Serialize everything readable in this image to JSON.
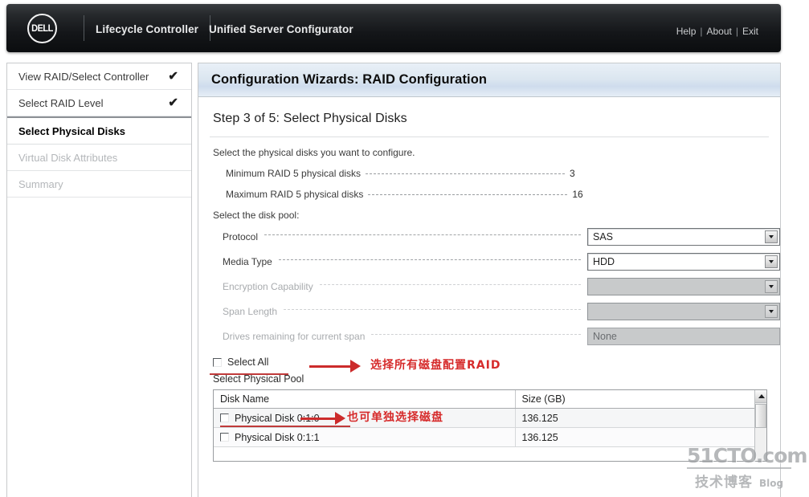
{
  "header": {
    "logo_text": "DELL",
    "brand_primary": "Lifecycle Controller",
    "brand_secondary": "Unified Server Configurator",
    "links": {
      "help": "Help",
      "about": "About",
      "exit": "Exit",
      "separator": "|"
    }
  },
  "sidebar": {
    "items": [
      {
        "label": "View RAID/Select Controller",
        "state": "done",
        "check": "✔"
      },
      {
        "label": "Select RAID Level",
        "state": "done",
        "check": "✔"
      },
      {
        "label": "Select Physical Disks",
        "state": "current",
        "check": ""
      },
      {
        "label": "Virtual Disk Attributes",
        "state": "disabled",
        "check": ""
      },
      {
        "label": "Summary",
        "state": "disabled",
        "check": ""
      }
    ]
  },
  "main": {
    "panel_title": "Configuration Wizards: RAID Configuration",
    "step_title": "Step 3 of 5: Select Physical Disks",
    "instruction": "Select the physical disks you want to configure.",
    "info_rows": [
      {
        "label": "Minimum RAID 5 physical disks",
        "value": "3"
      },
      {
        "label": "Maximum RAID 5 physical disks",
        "value": "16"
      }
    ],
    "disk_pool_heading": "Select the disk pool:",
    "fields": [
      {
        "label": "Protocol",
        "value": "SAS",
        "control": "dropdown",
        "disabled": false
      },
      {
        "label": "Media Type",
        "value": "HDD",
        "control": "dropdown",
        "disabled": false
      },
      {
        "label": "Encryption Capability",
        "value": "",
        "control": "dropdown",
        "disabled": true
      },
      {
        "label": "Span Length",
        "value": "",
        "control": "dropdown",
        "disabled": true
      },
      {
        "label": "Drives remaining for current span",
        "value": "None",
        "control": "textbox",
        "disabled": true
      }
    ],
    "select_all_label": "Select All",
    "select_all_checked": false,
    "physical_pool_label": "Select Physical Pool",
    "table": {
      "columns": [
        "Disk Name",
        "Size (GB)"
      ],
      "rows": [
        {
          "checked": false,
          "name": "Physical Disk 0:1:0",
          "size": "136.125"
        },
        {
          "checked": false,
          "name": "Physical Disk 0:1:1",
          "size": "136.125"
        }
      ]
    }
  },
  "annotations": [
    {
      "text": "选择所有磁盘配置RAID",
      "color": "#d62b2b"
    },
    {
      "text": "也可单独选择磁盘",
      "color": "#d62b2b"
    }
  ],
  "watermark": {
    "main": "51CTO.com",
    "chinese": "技术博客",
    "blog": "Blog"
  },
  "colors": {
    "annotation_red": "#d62b2b",
    "header_dark": "#141619",
    "panel_header_blue": "#dbe6f0"
  }
}
